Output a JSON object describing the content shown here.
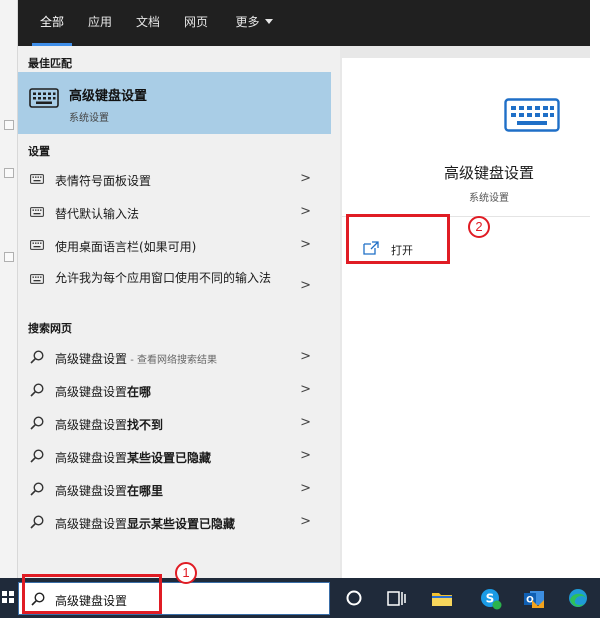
{
  "tabs": [
    {
      "label": "全部",
      "active": true
    },
    {
      "label": "应用"
    },
    {
      "label": "文档"
    },
    {
      "label": "网页"
    },
    {
      "label": "更多"
    }
  ],
  "best_match": {
    "section_label": "最佳匹配",
    "title": "高级键盘设置",
    "subtitle": "系统设置",
    "icon": "keyboard-icon"
  },
  "settings": {
    "section_label": "设置",
    "items": [
      {
        "label": "表情符号面板设置",
        "icon": "keyboard-small-icon"
      },
      {
        "label": "替代默认输入法",
        "icon": "keyboard-small-icon"
      },
      {
        "label": "使用桌面语言栏(如果可用)",
        "icon": "keyboard-small-icon"
      },
      {
        "label": "允许我为每个应用窗口使用不同的输入法",
        "icon": "keyboard-small-icon"
      }
    ]
  },
  "web": {
    "section_label": "搜索网页",
    "items": [
      {
        "prefix": "高级键盘设置",
        "suffix": "",
        "note": " - 查看网络搜索结果"
      },
      {
        "prefix": "高级键盘设置",
        "suffix": "在哪",
        "note": ""
      },
      {
        "prefix": "高级键盘设置",
        "suffix": "找不到",
        "note": ""
      },
      {
        "prefix": "高级键盘设置",
        "suffix": "某些设置已隐藏",
        "note": ""
      },
      {
        "prefix": "高级键盘设置",
        "suffix": "在哪里",
        "note": ""
      },
      {
        "prefix": "高级键盘设置",
        "suffix": "显示某些设置已隐藏",
        "note": ""
      }
    ]
  },
  "chevron": ">",
  "preview": {
    "title": "高级键盘设置",
    "subtitle": "系统设置",
    "open_label": "打开"
  },
  "search": {
    "value": "高级键盘设置"
  },
  "annotations": {
    "one": "1",
    "two": "2"
  },
  "colors": {
    "accent": "#3f8ee8",
    "selection": "#a9cde6",
    "annotation": "#e01c24",
    "icon_blue": "#1f6fc7",
    "taskbar": "#1f2a3a"
  }
}
